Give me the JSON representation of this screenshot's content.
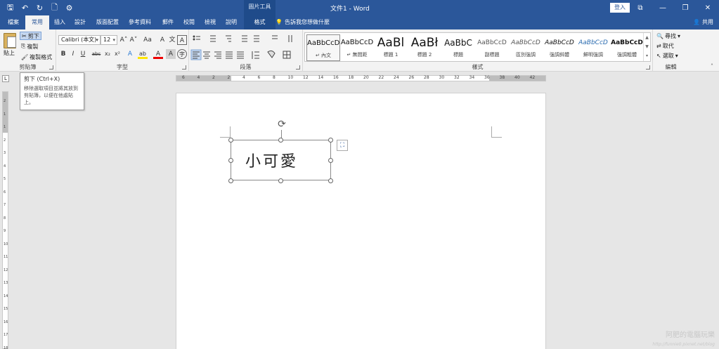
{
  "titlebar": {
    "title": "文件1 - Word",
    "context_header": "圖片工具",
    "login": "登入",
    "qat": {
      "save": "🖫",
      "undo": "↶",
      "redo": "↻",
      "new": "🗋",
      "extra": "⚙"
    },
    "win": {
      "options": "⧉",
      "minimize": "—",
      "restore": "❐",
      "close": "✕"
    }
  },
  "tabs": {
    "file": "檔案",
    "home": "常用",
    "insert": "插入",
    "design": "設計",
    "layout": "版面配置",
    "references": "參考資料",
    "mailings": "郵件",
    "review": "校閱",
    "view": "檢視",
    "help": "說明",
    "format": "格式"
  },
  "tellme": "告訴我您想做什麼",
  "share": "共用",
  "clipboard": {
    "paste": "貼上",
    "cut": "剪下",
    "copy": "複製",
    "format_painter": "複製格式",
    "label": "剪貼簿"
  },
  "font": {
    "name": "Calibri (本文)",
    "size": "12",
    "label": "字型",
    "grow": "A˄",
    "shrink": "A˅",
    "case": "Aa",
    "clear": "A",
    "zhuyin": "文",
    "border": "A",
    "bold": "B",
    "italic": "I",
    "underline": "U",
    "strike": "abc",
    "sub": "x₂",
    "sup": "x²",
    "effects": "A",
    "highlight": "ab",
    "color": "A",
    "shade": "A",
    "circle": "字"
  },
  "paragraph": {
    "label": "段落"
  },
  "styles": {
    "label": "樣式",
    "items": [
      {
        "sample": "AaBbCcD",
        "name": "↵ 內文"
      },
      {
        "sample": "AaBbCcD",
        "name": "↵ 無間距"
      },
      {
        "sample": "AaBl",
        "name": "標題 1"
      },
      {
        "sample": "AaBł",
        "name": "標題 2"
      },
      {
        "sample": "AaBbC",
        "name": "標題"
      },
      {
        "sample": "AaBbCcD",
        "name": "副標題"
      },
      {
        "sample": "AaBbCcD",
        "name": "區別強調"
      },
      {
        "sample": "AaBbCcD",
        "name": "強調斜體"
      },
      {
        "sample": "AaBbCcD",
        "name": "鮮明強調"
      },
      {
        "sample": "AaBbCcD",
        "name": "強調粗體"
      }
    ]
  },
  "editing": {
    "find": "尋找",
    "replace": "取代",
    "select": "選取",
    "label": "編輯"
  },
  "tooltip": {
    "title": "剪下 (Ctrl+X)",
    "desc": "移除選取項目並將其放到剪貼簿，以便在他處貼上。"
  },
  "ruler": {
    "corner": "L",
    "h_numbers": [
      "6",
      "4",
      "2",
      "2",
      "4",
      "6",
      "8",
      "10",
      "12",
      "14",
      "16",
      "18",
      "20",
      "22",
      "24",
      "26",
      "28",
      "30",
      "32",
      "34",
      "36",
      "38",
      "40",
      "42"
    ],
    "v_numbers": [
      "2",
      "1",
      "1",
      "2",
      "3",
      "4",
      "5",
      "6",
      "7",
      "8",
      "9",
      "10",
      "11",
      "12",
      "13",
      "14",
      "15",
      "16",
      "17",
      "18"
    ]
  },
  "document": {
    "image_text": "小可愛",
    "rotate_glyph": "⟳",
    "layout_glyph": "⛶"
  },
  "watermark": "阿肥的電腦玩樂",
  "watermark_url": "http://funnie0.pixnet.net/blog"
}
